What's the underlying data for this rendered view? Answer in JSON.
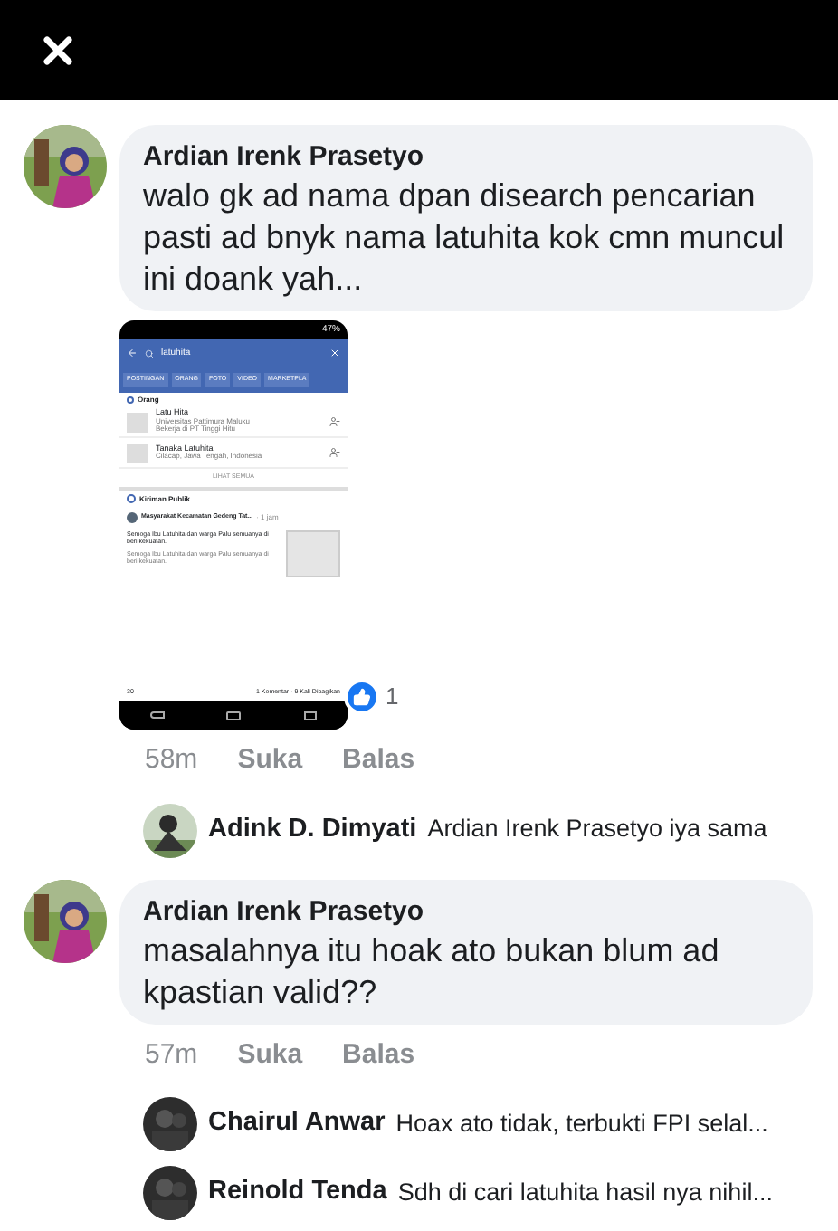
{
  "comments": [
    {
      "author": "Ardian Irenk Prasetyo",
      "text": "walo gk ad nama dpan disearch pencarian pasti ad bnyk nama latuhita kok cmn muncul ini doank yah...",
      "attachment": {
        "status": "47%",
        "search": "latuhita",
        "tabs": [
          "POSTINGAN",
          "ORANG",
          "FOTO",
          "VIDEO",
          "MARKETPLA"
        ],
        "people_heading": "Orang",
        "people": [
          {
            "name": "Latu Hita",
            "lines": [
              "Universitas Pattimura Maluku",
              "Bekerja di PT Tinggi Hitu"
            ]
          },
          {
            "name": "Tanaka Latuhita",
            "lines": [
              "Cilacap, Jawa Tengah, Indonesia"
            ]
          }
        ],
        "see_all": "LIHAT SEMUA",
        "posts_heading": "Kiriman Publik",
        "post": {
          "page": "Masyarakat Kecamatan Gedeng Tat...",
          "time": "· 1 jam",
          "text": "Semoga Ibu Latuhita dan warga Palu semuanya di beri kekuatan.",
          "repeat": "Semoga Ibu Latuhita dan warga Palu semuanya di beri kekuatan.",
          "reactions": "30",
          "stats": "1 Komentar · 9 Kali Dibagikan"
        }
      },
      "reaction_count": "1",
      "time": "58m",
      "like": "Suka",
      "reply": "Balas",
      "replies": [
        {
          "author": "Adink D. Dimyati",
          "text": "Ardian Irenk Prasetyo iya sama"
        }
      ]
    },
    {
      "author": "Ardian Irenk Prasetyo",
      "text": "masalahnya itu hoak ato bukan blum ad kpastian valid??",
      "time": "57m",
      "like": "Suka",
      "reply": "Balas",
      "replies": [
        {
          "author": "Chairul Anwar",
          "text": "Hoax ato tidak, terbukti FPI selal..."
        },
        {
          "author": "Reinold Tenda",
          "text": "Sdh di cari latuhita hasil nya nihil..."
        }
      ]
    }
  ]
}
